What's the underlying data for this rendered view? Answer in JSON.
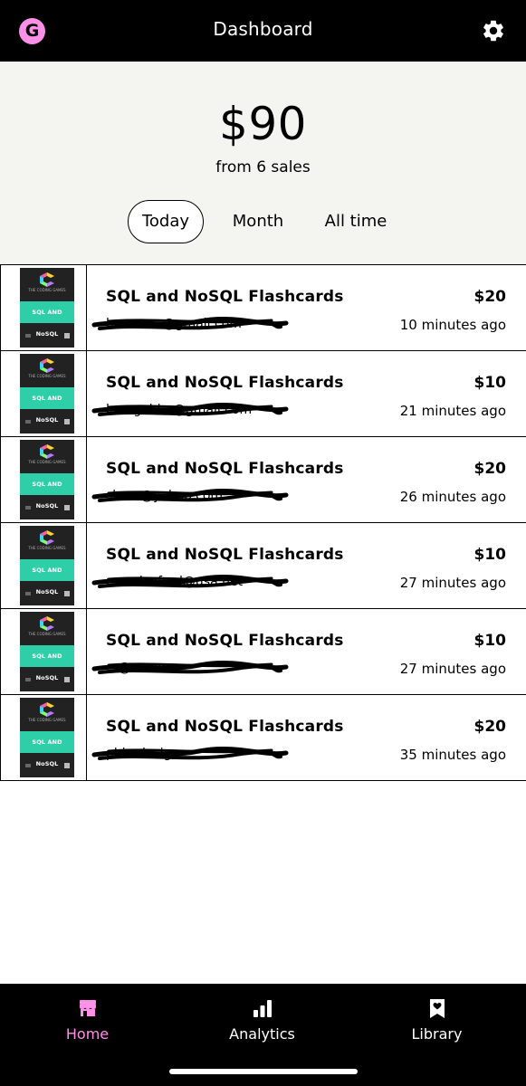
{
  "header": {
    "logo_letter": "G",
    "title": "Dashboard",
    "settings_icon": "gear-icon",
    "brand_color": "#ff90e8"
  },
  "summary": {
    "amount": "$90",
    "subtitle": "from 6 sales"
  },
  "tabs": [
    {
      "label": "Today",
      "selected": true
    },
    {
      "label": "Month",
      "selected": false
    },
    {
      "label": "All time",
      "selected": false
    }
  ],
  "sales": [
    {
      "product": "SQL and NoSQL Flashcards",
      "email": "hernan...@gmail.com",
      "price": "$20",
      "time": "10 minutes ago"
    },
    {
      "product": "SQL and NoSQL Flashcards",
      "email": "lar...gold...@gmail.com",
      "price": "$10",
      "time": "21 minutes ago"
    },
    {
      "product": "SQL and NoSQL Flashcards",
      "email": "sha...@yahoo.com",
      "price": "$20",
      "time": "26 minutes ago"
    },
    {
      "product": "SQL and NoSQL Flashcards",
      "email": "mauriceford@usa.net",
      "price": "$10",
      "time": "27 minutes ago"
    },
    {
      "product": "SQL and NoSQL Flashcards",
      "email": "...@....com",
      "price": "$10",
      "time": "27 minutes ago"
    },
    {
      "product": "SQL and NoSQL Flashcards",
      "email": "phi...design",
      "price": "$20",
      "time": "35 minutes ago"
    }
  ],
  "product_cover": {
    "band_text": "SQL AND NoSQL",
    "brand_text": "THE CODING GAMES",
    "band_color": "#2ecfa8"
  },
  "nav": [
    {
      "label": "Home",
      "icon": "store-icon",
      "active": true
    },
    {
      "label": "Analytics",
      "icon": "bar-chart-icon",
      "active": false
    },
    {
      "label": "Library",
      "icon": "bookmark-heart-icon",
      "active": false
    }
  ]
}
